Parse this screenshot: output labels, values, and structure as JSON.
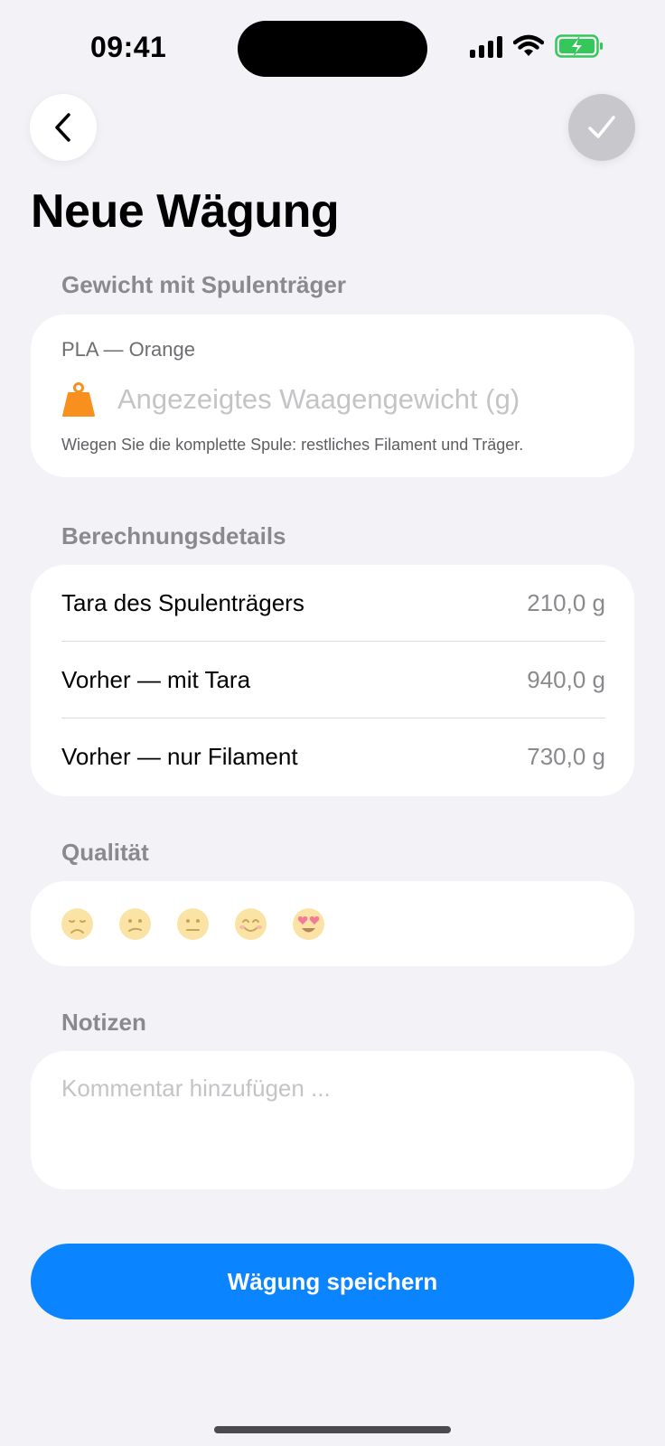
{
  "status_bar": {
    "time": "09:41"
  },
  "page": {
    "title": "Neue Wägung"
  },
  "weight_section": {
    "header": "Gewicht mit Spulenträger",
    "material": "PLA — Orange",
    "input_placeholder": "Angezeigtes Waagengewicht (g)",
    "input_value": "",
    "hint": "Wiegen Sie die komplette Spule: restliches Filament und Träger.",
    "icon": "weight-icon",
    "icon_color": "#F7901E"
  },
  "details_section": {
    "header": "Berechnungsdetails",
    "rows": [
      {
        "label": "Tara des Spulenträgers",
        "value": "210,0 g"
      },
      {
        "label": "Vorher — mit Tara",
        "value": "940,0 g"
      },
      {
        "label": "Vorher — nur Filament",
        "value": "730,0 g"
      }
    ]
  },
  "quality_section": {
    "header": "Qualität",
    "options": [
      "disappointed-face",
      "confused-face",
      "neutral-face",
      "smiling-face",
      "heart-eyes-face"
    ],
    "selected": null
  },
  "notes_section": {
    "header": "Notizen",
    "placeholder": "Kommentar hinzufügen ...",
    "value": ""
  },
  "actions": {
    "save_label": "Wägung speichern"
  },
  "colors": {
    "accent": "#0A84FF",
    "background": "#F2F2F7",
    "confirm_disabled": "#C7C7CC",
    "battery_charging": "#34C759"
  }
}
